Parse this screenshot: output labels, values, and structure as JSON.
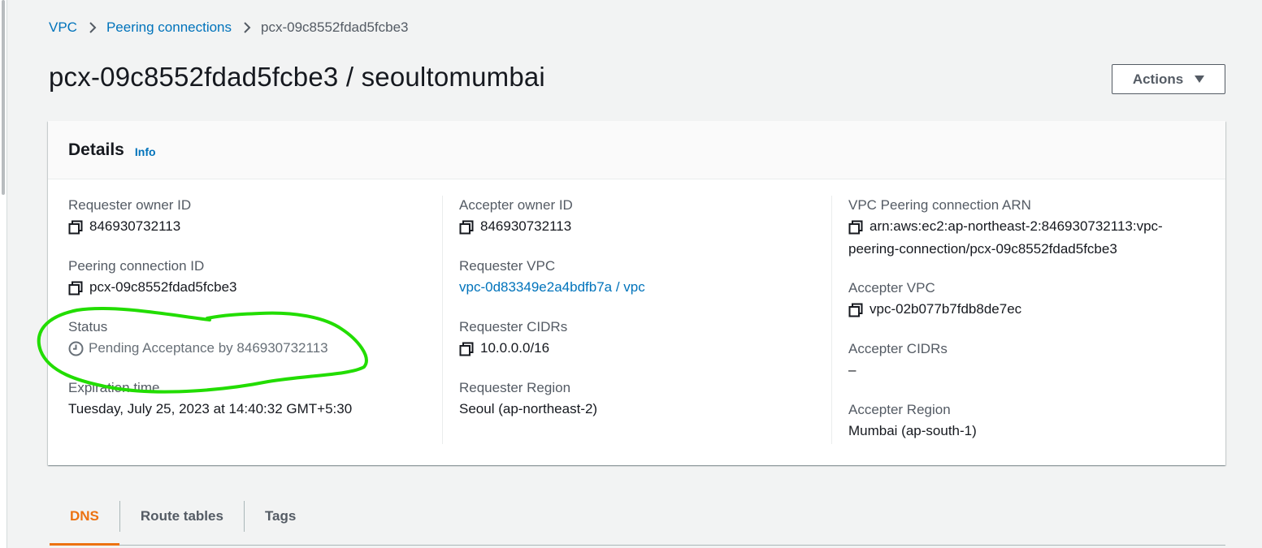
{
  "breadcrumb": {
    "items": [
      "VPC",
      "Peering connections"
    ],
    "current": "pcx-09c8552fdad5fcbe3"
  },
  "page": {
    "title": "pcx-09c8552fdad5fcbe3 / seoultomumbai",
    "actions_label": "Actions"
  },
  "details": {
    "title": "Details",
    "info_label": "Info",
    "col1": {
      "requester_owner_id_label": "Requester owner ID",
      "requester_owner_id": "846930732113",
      "peering_connection_id_label": "Peering connection ID",
      "peering_connection_id": "pcx-09c8552fdad5fcbe3",
      "status_label": "Status",
      "status": "Pending Acceptance by 846930732113",
      "expiration_label": "Expiration time",
      "expiration": "Tuesday, July 25, 2023 at 14:40:32 GMT+5:30"
    },
    "col2": {
      "accepter_owner_id_label": "Accepter owner ID",
      "accepter_owner_id": "846930732113",
      "requester_vpc_label": "Requester VPC",
      "requester_vpc": "vpc-0d83349e2a4bdfb7a / vpc",
      "requester_cidrs_label": "Requester CIDRs",
      "requester_cidrs": "10.0.0.0/16",
      "requester_region_label": "Requester Region",
      "requester_region": "Seoul (ap-northeast-2)"
    },
    "col3": {
      "arn_label": "VPC Peering connection ARN",
      "arn_line1": "arn:aws:ec2:ap-northeast-2:846930732113:vpc-",
      "arn_line2": "peering-connection/pcx-09c8552fdad5fcbe3",
      "accepter_vpc_label": "Accepter VPC",
      "accepter_vpc": "vpc-02b077b7fdb8de7ec",
      "accepter_cidrs_label": "Accepter CIDRs",
      "accepter_cidrs": "–",
      "accepter_region_label": "Accepter Region",
      "accepter_region": "Mumbai (ap-south-1)"
    }
  },
  "tabs": [
    {
      "label": "DNS",
      "active": true
    },
    {
      "label": "Route tables",
      "active": false
    },
    {
      "label": "Tags",
      "active": false
    }
  ],
  "colors": {
    "link": "#0073bb",
    "active_tab": "#ec7211",
    "annotation": "#22dd00"
  },
  "icons": {
    "copy": "copy-icon",
    "status": "clock-icon",
    "breadcrumb_separator": "chevron-right-icon",
    "dropdown": "caret-down-icon"
  }
}
